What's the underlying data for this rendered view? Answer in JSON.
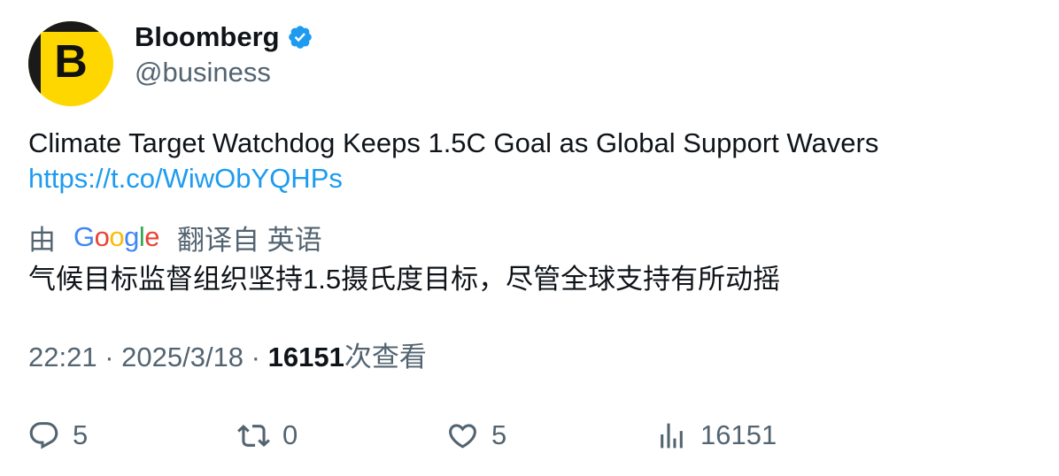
{
  "author": {
    "avatar_letter": "B",
    "display_name": "Bloomberg",
    "handle": "@business",
    "verified_icon": "verified-badge-icon",
    "verified_color": "#1d9bf0"
  },
  "tweet": {
    "text": "Climate Target Watchdog Keeps 1.5C Goal as Global Support Wavers",
    "link": "https://t.co/WiwObYQHPs",
    "link_color": "#1d9bf0"
  },
  "translation": {
    "prefix": "由",
    "provider": "Google",
    "suffix": "翻译自 英语",
    "text": "气候目标监督组织坚持1.5摄氏度目标，尽管全球支持有所动摇"
  },
  "meta": {
    "time": "22:21",
    "separator": " · ",
    "date": "2025/3/18",
    "views_count": "16151",
    "views_label": "次查看"
  },
  "actions": {
    "reply": {
      "icon": "reply-icon",
      "count": "5"
    },
    "retweet": {
      "icon": "retweet-icon",
      "count": "0"
    },
    "like": {
      "icon": "heart-icon",
      "count": "5"
    },
    "views": {
      "icon": "analytics-icon",
      "count": "16151"
    }
  },
  "colors": {
    "text_primary": "#0f1419",
    "text_secondary": "#536471",
    "avatar_bg": "#ffd700"
  }
}
